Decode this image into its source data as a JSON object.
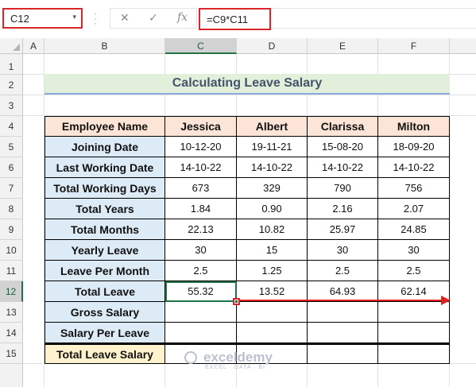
{
  "formula_bar": {
    "name_box": "C12",
    "name_box_caret": "▾",
    "cancel_icon": "✕",
    "enter_icon": "✓",
    "fx_icon": "fx",
    "formula": "=C9*C11"
  },
  "columns": [
    "A",
    "B",
    "C",
    "D",
    "E",
    "F"
  ],
  "rows": [
    "1",
    "2",
    "3",
    "4",
    "5",
    "6",
    "7",
    "8",
    "9",
    "10",
    "11",
    "12",
    "13",
    "14",
    "15"
  ],
  "selected_column": "C",
  "selected_row": "12",
  "title": "Calculating Leave Salary",
  "table": {
    "header": [
      "Employee Name",
      "Jessica",
      "Albert",
      "Clarissa",
      "Milton"
    ],
    "rows": [
      [
        "Joining Date",
        "10-12-20",
        "19-11-21",
        "15-08-20",
        "18-09-20"
      ],
      [
        "Last Working Date",
        "14-10-22",
        "14-10-22",
        "14-10-22",
        "14-10-22"
      ],
      [
        "Total Working Days",
        "673",
        "329",
        "790",
        "756"
      ],
      [
        "Total Years",
        "1.84",
        "0.90",
        "2.16",
        "2.07"
      ],
      [
        "Total Months",
        "22.13",
        "10.82",
        "25.97",
        "24.85"
      ],
      [
        "Yearly Leave",
        "30",
        "15",
        "30",
        "30"
      ],
      [
        "Leave Per Month",
        "2.5",
        "1.25",
        "2.5",
        "2.5"
      ],
      [
        "Total Leave",
        "55.32",
        "13.52",
        "64.93",
        "62.14"
      ],
      [
        "Gross Salary",
        "",
        "",
        "",
        ""
      ],
      [
        "Salary Per Leave",
        "",
        "",
        "",
        ""
      ],
      [
        "Total Leave Salary",
        "",
        "",
        "",
        ""
      ]
    ]
  },
  "watermark": {
    "name": "exceldemy",
    "tagline": "EXCEL · DATA · BI"
  },
  "colors": {
    "header_fill": "#fce4d6",
    "label_fill": "#ddebf7",
    "total_fill": "#fff2cc",
    "title_fill": "#e2efda",
    "highlight_red": "#d9262b",
    "excel_green": "#217346"
  }
}
